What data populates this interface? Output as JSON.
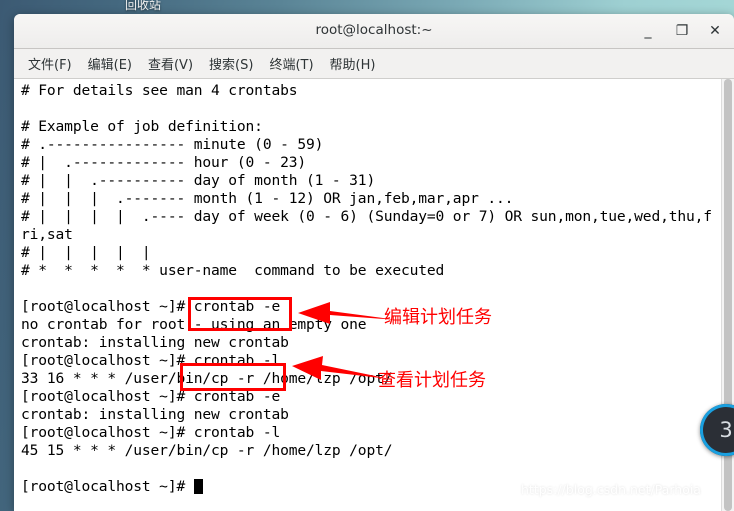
{
  "desktop": {
    "icon_label": "回收站",
    "badge_text": "3",
    "bg_left_color": "#3c5a73",
    "bg_right_color": "#a9dcd9"
  },
  "window": {
    "title": "root@localhost:~",
    "buttons": {
      "minimize": "_",
      "maximize": "❐",
      "close": "✕"
    }
  },
  "menubar": {
    "items": [
      {
        "label": "文件(F)"
      },
      {
        "label": "编辑(E)"
      },
      {
        "label": "查看(V)"
      },
      {
        "label": "搜索(S)"
      },
      {
        "label": "终端(T)"
      },
      {
        "label": "帮助(H)"
      }
    ]
  },
  "terminal": {
    "content": "# For details see man 4 crontabs\n\n# Example of job definition:\n# .---------------- minute (0 - 59)\n# |  .------------- hour (0 - 23)\n# |  |  .---------- day of month (1 - 31)\n# |  |  |  .------- month (1 - 12) OR jan,feb,mar,apr ...\n# |  |  |  |  .---- day of week (0 - 6) (Sunday=0 or 7) OR sun,mon,tue,wed,thu,f\nri,sat\n# |  |  |  |  |\n# *  *  *  *  * user-name  command to be executed\n\n[root@localhost ~]# crontab -e\nno crontab for root - using an empty one\ncrontab: installing new crontab\n[root@localhost ~]# crontab -l\n33 16 * * * /user/bin/cp -r /home/lzp /opt/\n[root@localhost ~]# crontab -e\ncrontab: installing new crontab\n[root@localhost ~]# crontab -l\n45 15 * * * /user/bin/cp -r /home/lzp /opt/\n\n[root@localhost ~]# ",
    "prompt": "[root@localhost ~]# ",
    "commands": [
      "crontab -e",
      "crontab -l",
      "crontab -e",
      "crontab -l"
    ],
    "outputs": [
      "no crontab for root - using an empty one",
      "crontab: installing new crontab",
      "33 16 * * * /user/bin/cp -r /home/lzp /opt/",
      "crontab: installing new crontab",
      "45 15 * * * /user/bin/cp -r /home/lzp /opt/"
    ]
  },
  "annotations": {
    "color": "#ff0000",
    "items": [
      {
        "label": "编辑计划任务",
        "target": "crontab -e"
      },
      {
        "label": "查看计划任务",
        "target": "crontab -l"
      }
    ]
  },
  "watermark": {
    "text": "https://blog.csdn.net/Parhoia"
  }
}
